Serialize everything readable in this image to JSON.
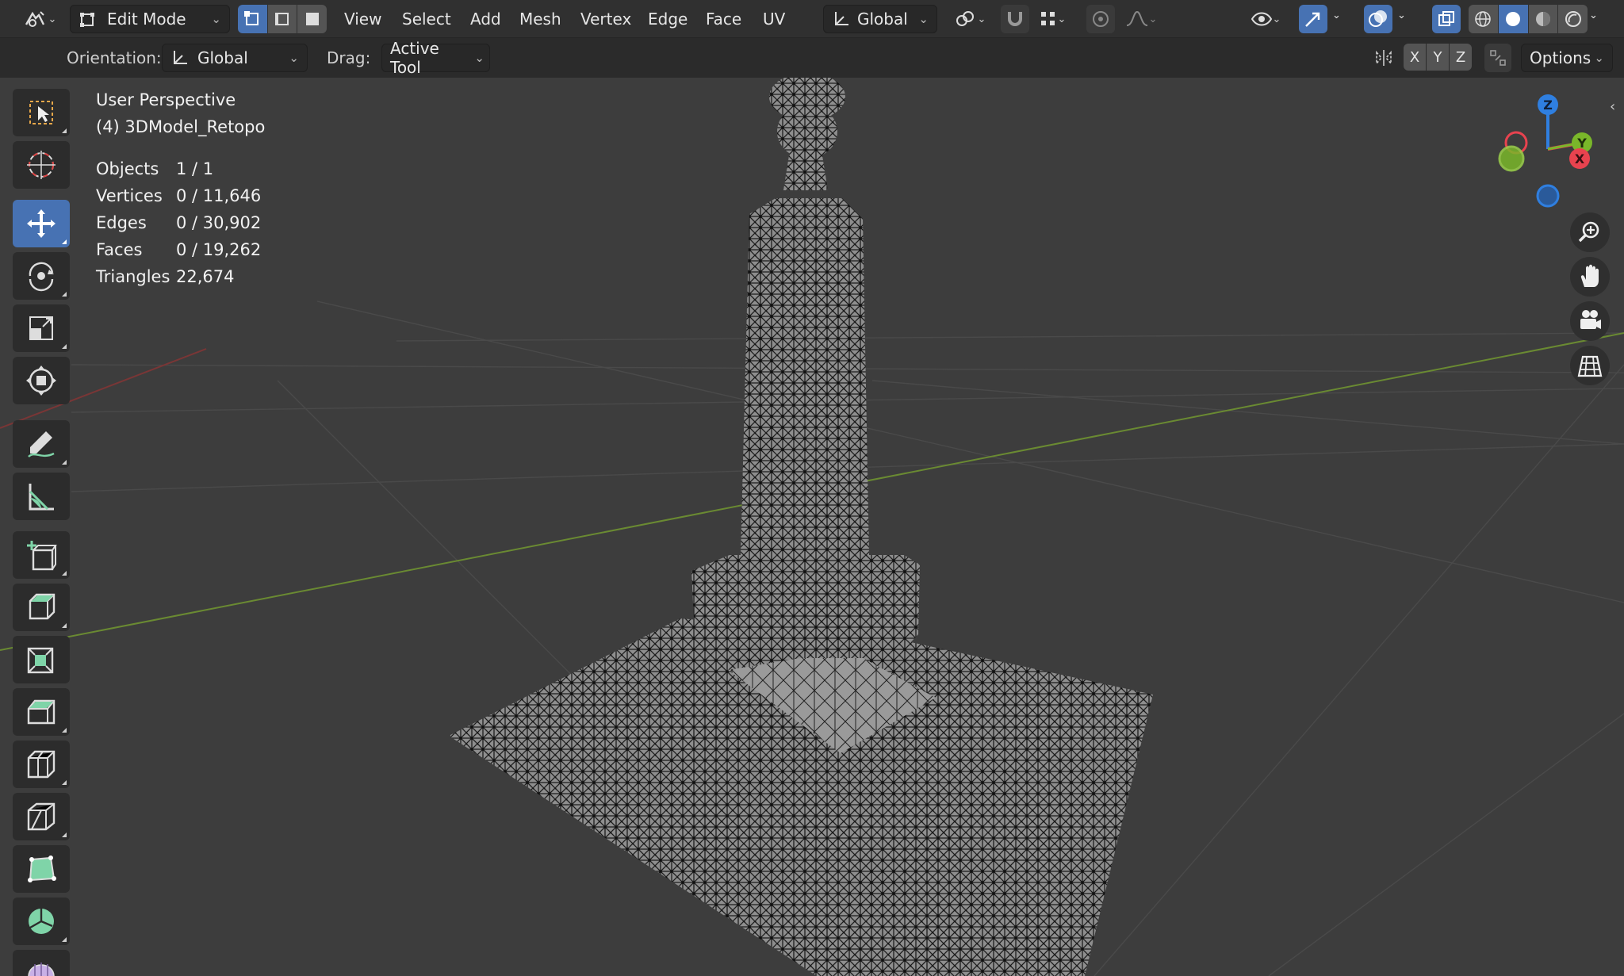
{
  "header": {
    "mode": "Edit Mode",
    "menus": [
      "View",
      "Select",
      "Add",
      "Mesh",
      "Vertex",
      "Edge",
      "Face",
      "UV"
    ],
    "transform_orientation": "Global"
  },
  "tool_settings": {
    "orientation_label": "Orientation:",
    "orientation_value": "Global",
    "drag_label": "Drag:",
    "drag_value": "Active Tool",
    "axes": [
      "X",
      "Y",
      "Z"
    ],
    "options_label": "Options"
  },
  "viewport": {
    "view_name": "User Perspective",
    "object_name": "(4) 3DModel_Retopo",
    "stats": [
      {
        "label": "Objects",
        "value": "1 / 1"
      },
      {
        "label": "Vertices",
        "value": "0 / 11,646"
      },
      {
        "label": "Edges",
        "value": "0 / 30,902"
      },
      {
        "label": "Faces",
        "value": "0 / 19,262"
      },
      {
        "label": "Triangles",
        "value": "22,674"
      }
    ]
  },
  "gizmo": {
    "z": "Z",
    "y": "Y",
    "x": "X"
  },
  "colors": {
    "accent": "#4772b3",
    "axis_x": "#e8434f",
    "axis_y": "#7ab72a",
    "axis_z": "#2f7fe0",
    "grid_green": "#6a8a32",
    "grid_red": "#7a3636",
    "tool_green": "#7fd4a8"
  },
  "icons": {
    "toolbar": [
      "select-box-icon",
      "cursor-icon",
      "move-icon",
      "rotate-icon",
      "scale-icon",
      "transform-icon",
      "annotate-icon",
      "measure-icon",
      "add-cube-icon",
      "extrude-icon",
      "inset-icon",
      "bevel-icon",
      "loop-cut-icon",
      "knife-icon",
      "poly-build-icon",
      "spin-icon",
      "smooth-icon"
    ],
    "nav": [
      "zoom-icon",
      "pan-hand-icon",
      "camera-icon",
      "grid-view-icon"
    ]
  }
}
